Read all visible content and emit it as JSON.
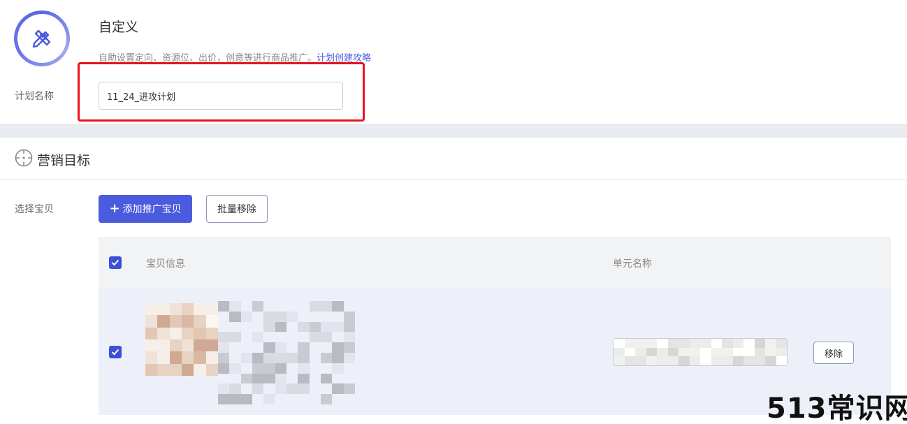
{
  "header": {
    "title": "自定义",
    "description": "自助设置定向、资源位、出价，创意等进行商品推广。",
    "guide_link": "计划创建攻略"
  },
  "plan": {
    "label": "计划名称",
    "value": "11_24_进攻计划"
  },
  "marketing": {
    "section_title": "营销目标",
    "select_label": "选择宝贝",
    "add_button": "添加推广宝贝",
    "add_button_icon": "plus-icon",
    "batch_remove_button": "批量移除"
  },
  "table": {
    "columns": [
      "宝贝信息",
      "单元名称"
    ],
    "header_checked": true,
    "rows": [
      {
        "checked": true,
        "remove_label": "移除"
      }
    ]
  },
  "watermark": "513常识网",
  "colors": {
    "accent": "#4b5bdd",
    "highlight_border": "#e8141c",
    "link": "#4a5de0",
    "band": "#e8ebf0"
  }
}
